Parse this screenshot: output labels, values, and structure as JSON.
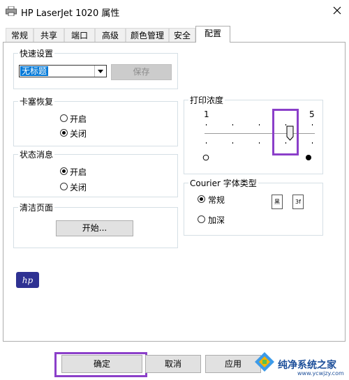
{
  "window": {
    "title": "HP LaserJet 1020 属性"
  },
  "tabs": [
    "常规",
    "共享",
    "端口",
    "高级",
    "颜色管理",
    "安全",
    "配置"
  ],
  "quick_settings": {
    "label": "快速设置",
    "combo_value": "无标题",
    "save_label": "保存"
  },
  "jam_recovery": {
    "label": "卡塞恢复",
    "on": "开启",
    "off": "关闭"
  },
  "status_message": {
    "label": "状态消息",
    "on": "开启",
    "off": "关闭"
  },
  "clean_page": {
    "label": "清洁页面",
    "start_label": "开始..."
  },
  "print_density": {
    "label": "打印浓度",
    "min_label": "1",
    "max_label": "5",
    "level": 4,
    "levels": 5
  },
  "courier": {
    "label": "Courier 字体类型",
    "regular": "常规",
    "dark": "加深",
    "sample_regular": "黑",
    "sample_dark": "3f"
  },
  "buttons": {
    "ok": "确定",
    "cancel": "取消",
    "apply": "应用"
  },
  "logo": {
    "text": "hp",
    "color": "#2e3192"
  },
  "watermark": {
    "name": "纯净系统之家",
    "url": "www.ycwjzy.com"
  },
  "colors": {
    "highlight": "#8b3fc9",
    "selection": "#0078d7"
  }
}
